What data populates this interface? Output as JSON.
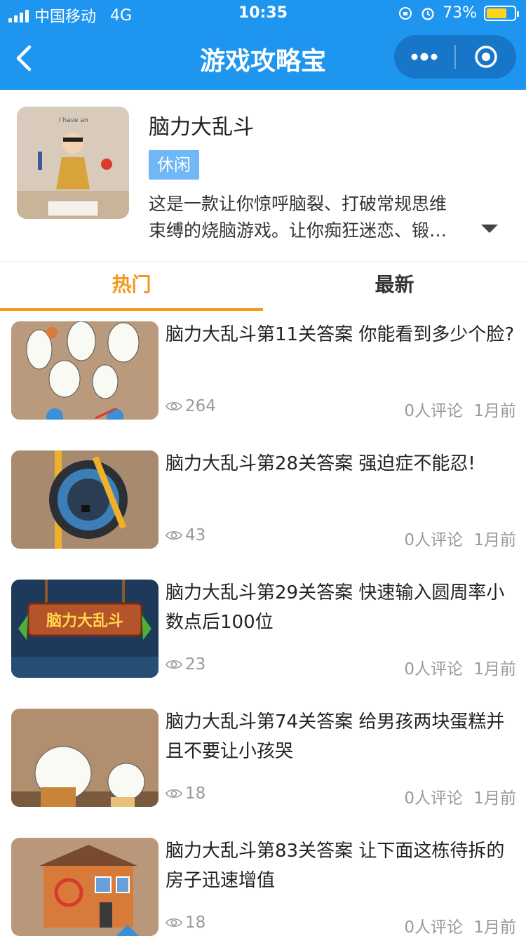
{
  "status_bar": {
    "carrier": "中国移动",
    "network": "4G",
    "time": "10:35",
    "battery": "73%",
    "battery_level": 0.73,
    "battery_color": "#ffd21f"
  },
  "nav": {
    "title": "游戏攻略宝",
    "back_icon": "chevron-left-icon",
    "more_icon": "more-dots-icon",
    "close_icon": "target-circle-icon"
  },
  "game": {
    "name": "脑力大乱斗",
    "tag": "休闲",
    "description_line1": "这是一款让你惊呼脑裂、打破常规思维",
    "description_line2": "束缚的烧脑游戏。让你痴狂迷恋、锻…",
    "expand_icon": "triangle-down-icon"
  },
  "tabs": {
    "hot": "热门",
    "newest": "最新"
  },
  "colors": {
    "brand_blue": "#1e96f0",
    "accent_orange": "#f39a1e",
    "tag_blue": "#6fb7f5",
    "meta_gray": "#999999"
  },
  "articles": [
    {
      "title": "脑力大乱斗第11关答案 你能看到多少个脸?",
      "views": "264",
      "comments": "0人评论",
      "time": "1月前"
    },
    {
      "title": "脑力大乱斗第28关答案 强迫症不能忍!",
      "views": "43",
      "comments": "0人评论",
      "time": "1月前"
    },
    {
      "title": "脑力大乱斗第29关答案 快速输入圆周率小数点后100位",
      "views": "23",
      "comments": "0人评论",
      "time": "1月前"
    },
    {
      "title": "脑力大乱斗第74关答案 给男孩两块蛋糕并且不要让小孩哭",
      "views": "18",
      "comments": "0人评论",
      "time": "1月前"
    },
    {
      "title": "脑力大乱斗第83关答案 让下面这栋待拆的房子迅速增值",
      "views": "18",
      "comments": "0人评论",
      "time": "1月前"
    }
  ]
}
